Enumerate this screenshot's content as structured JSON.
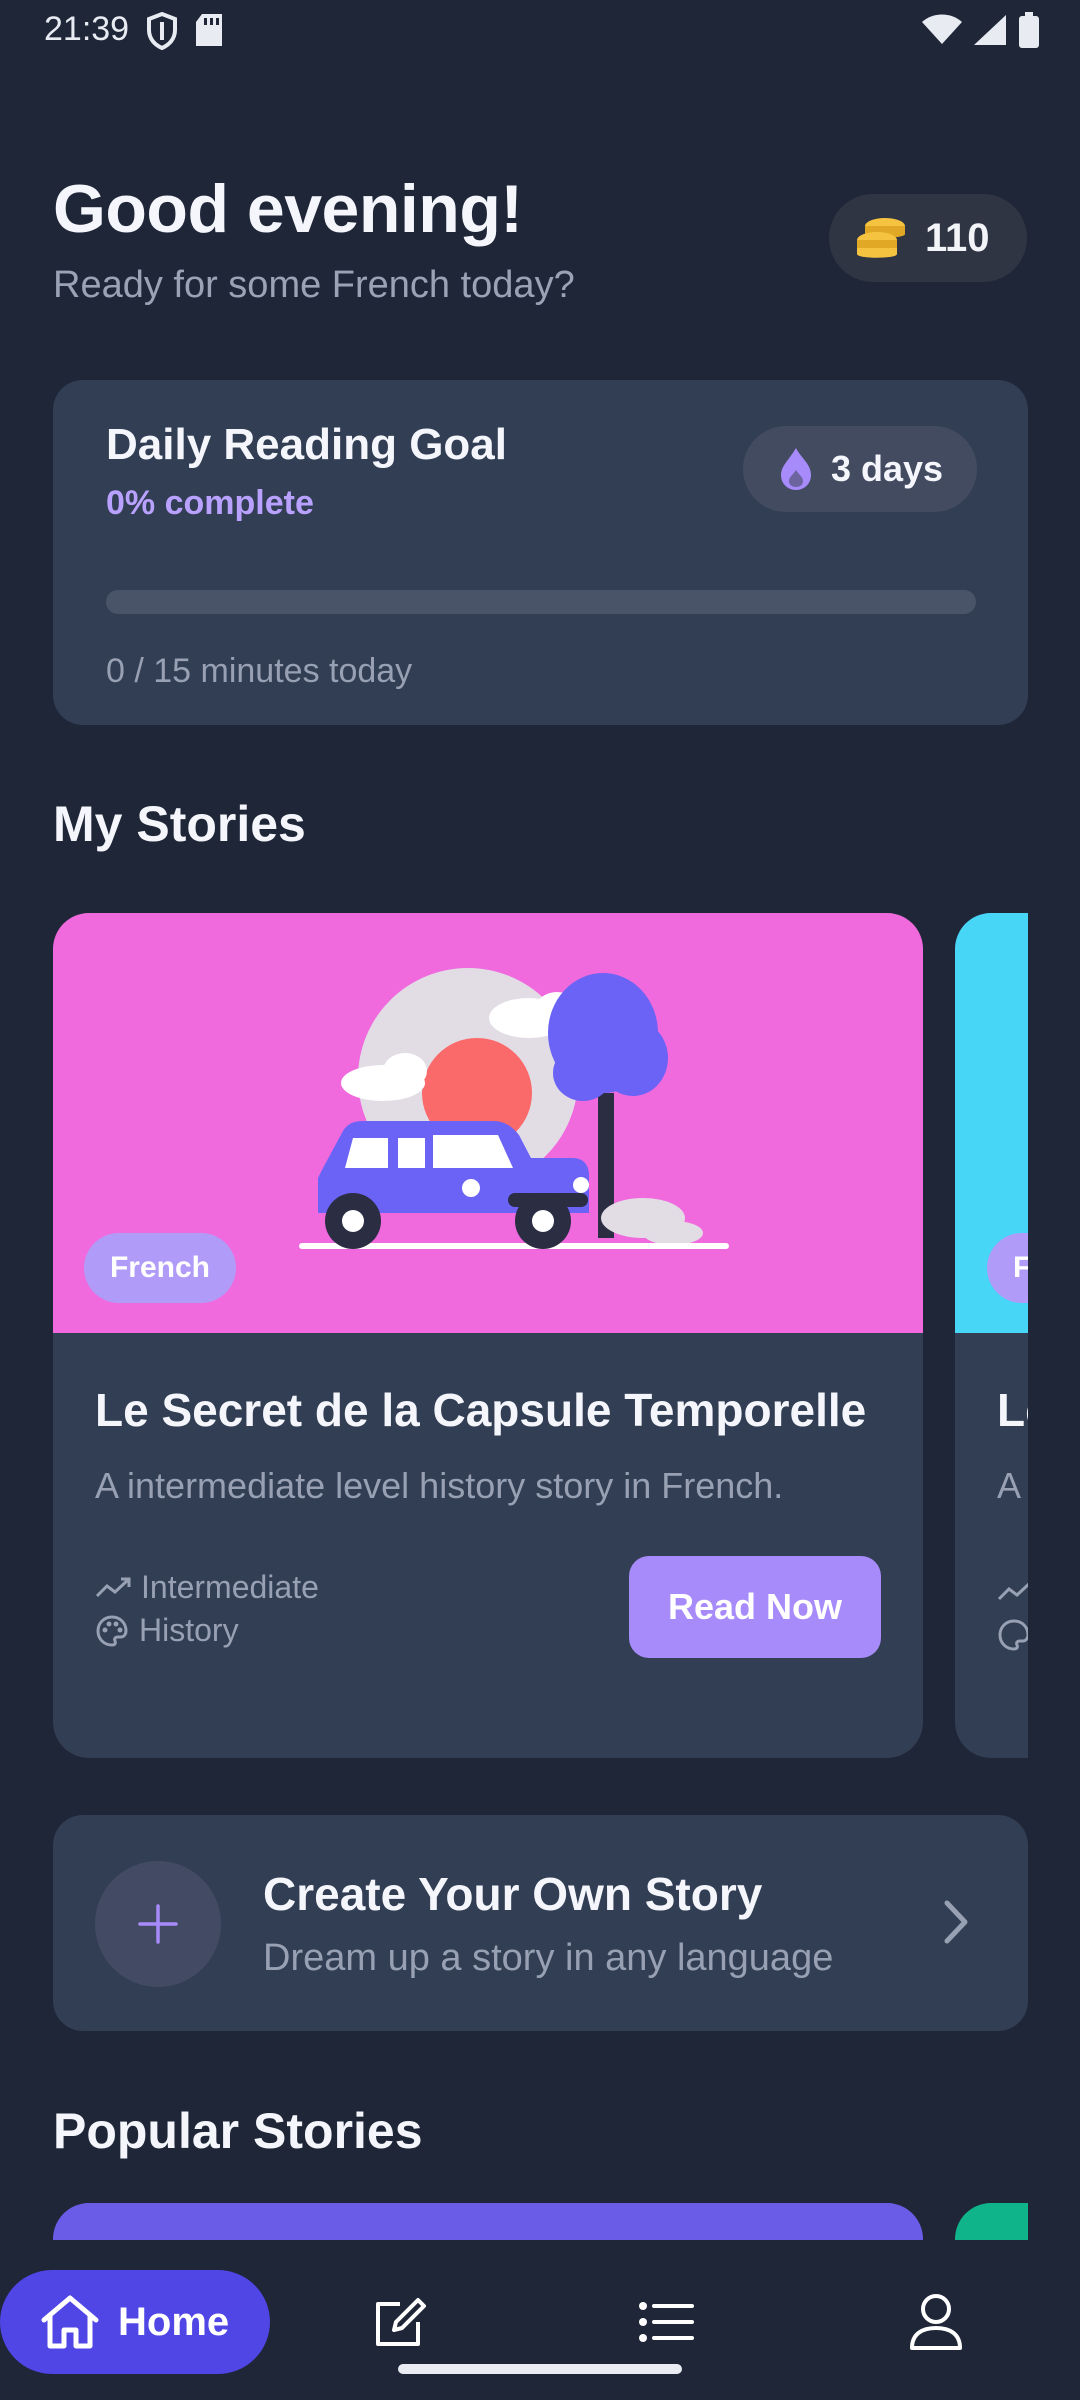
{
  "status_bar": {
    "time": "21:39"
  },
  "header": {
    "greeting": "Good evening!",
    "subtitle": "Ready for some French today?",
    "coins": "110"
  },
  "daily_goal": {
    "title": "Daily Reading Goal",
    "percent_label": "0% complete",
    "progress_fraction": 0,
    "streak_label": "3 days",
    "minutes_label": "0 / 15 minutes today"
  },
  "my_stories": {
    "section_title": "My Stories",
    "cards": [
      {
        "language": "French",
        "title": "Le Secret de la Capsule Temporelle",
        "description": "A intermediate level history story in French.",
        "level": "Intermediate",
        "genre": "History",
        "button_label": "Read Now",
        "cover_color": "#f06ade"
      },
      {
        "language": "F",
        "title": "Le",
        "description": "A",
        "cover_color": "#48d6f7"
      }
    ]
  },
  "create_story": {
    "title": "Create Your Own Story",
    "subtitle": "Dream up a story in any language"
  },
  "popular": {
    "section_title": "Popular Stories"
  },
  "bottom_nav": {
    "home_label": "Home",
    "items": [
      "home-icon",
      "edit-icon",
      "list-icon",
      "profile-icon"
    ]
  },
  "colors": {
    "background": "#1e2638",
    "card": "#323e54",
    "accent": "#a78bfa",
    "nav_active": "#4f46e5"
  }
}
